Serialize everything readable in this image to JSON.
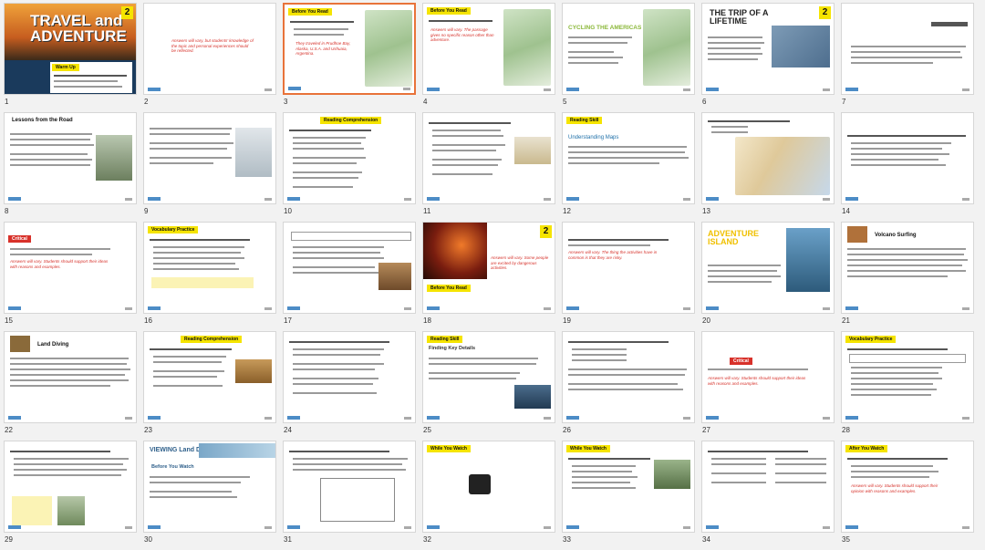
{
  "slides": [
    {
      "n": "1",
      "title": "TRAVEL and ADVENTURE",
      "badge": "2",
      "hdr": "Warm Up"
    },
    {
      "n": "2",
      "red": "Answers will vary, but students' knowledge of the topic and personal experiences should be reflected."
    },
    {
      "n": "3",
      "hdr": "Before You Read",
      "red": "They traveled in Prudhoe Bay, Alaska, U.S.A. and Ushuaia, Argentina."
    },
    {
      "n": "4",
      "hdr": "Before You Read",
      "red": "Answers will vary. The passage gives no specific reason other than adventure."
    },
    {
      "n": "5",
      "title": "CYCLING THE AMERICAS"
    },
    {
      "n": "6",
      "title": "THE TRIP OF A LIFETIME",
      "badge": "2"
    },
    {
      "n": "7"
    },
    {
      "n": "8",
      "hdr": "Lessons from the Road"
    },
    {
      "n": "9"
    },
    {
      "n": "10",
      "hdr": "Reading Comprehension"
    },
    {
      "n": "11"
    },
    {
      "n": "12",
      "hdr": "Reading Skill",
      "sub": "Understanding Maps"
    },
    {
      "n": "13"
    },
    {
      "n": "14"
    },
    {
      "n": "15",
      "hdr": "Critical",
      "red": "Answers will vary. Students should support their ideas with reasons and examples."
    },
    {
      "n": "16",
      "hdr": "Vocabulary Practice"
    },
    {
      "n": "17"
    },
    {
      "n": "18",
      "badge": "2",
      "hdr": "Before You Read",
      "red": "Answers will vary. Some people are excited by dangerous activities."
    },
    {
      "n": "19",
      "red": "Answers will vary. The thing the activities have in common is that they are risky."
    },
    {
      "n": "20",
      "title": "ADVENTURE ISLAND"
    },
    {
      "n": "21",
      "hdr": "Volcano Surfing"
    },
    {
      "n": "22",
      "hdr": "Land Diving"
    },
    {
      "n": "23",
      "hdr": "Reading Comprehension"
    },
    {
      "n": "24"
    },
    {
      "n": "25",
      "hdr": "Reading Skill",
      "sub": "Finding Key Details"
    },
    {
      "n": "26",
      "hdr": "Critical",
      "red": "Answers will vary. Students should support their ideas with reasons and examples."
    },
    {
      "n": "27",
      "hdr": "Vocabulary Practice"
    },
    {
      "n": "28"
    },
    {
      "n": "29"
    },
    {
      "n": "30",
      "title": "VIEWING Land Divers",
      "hdr": "Before You Watch"
    },
    {
      "n": "31"
    },
    {
      "n": "32",
      "hdr": "While You Watch"
    },
    {
      "n": "33",
      "hdr": "While You Watch"
    },
    {
      "n": "34"
    },
    {
      "n": "35",
      "hdr": "After You Watch",
      "red": "Answers will vary. Students should support their opinion with reasons and examples."
    }
  ],
  "colors": {
    "yellow": "#f5e400",
    "red": "#d6312a",
    "selected": "#e8733a"
  }
}
